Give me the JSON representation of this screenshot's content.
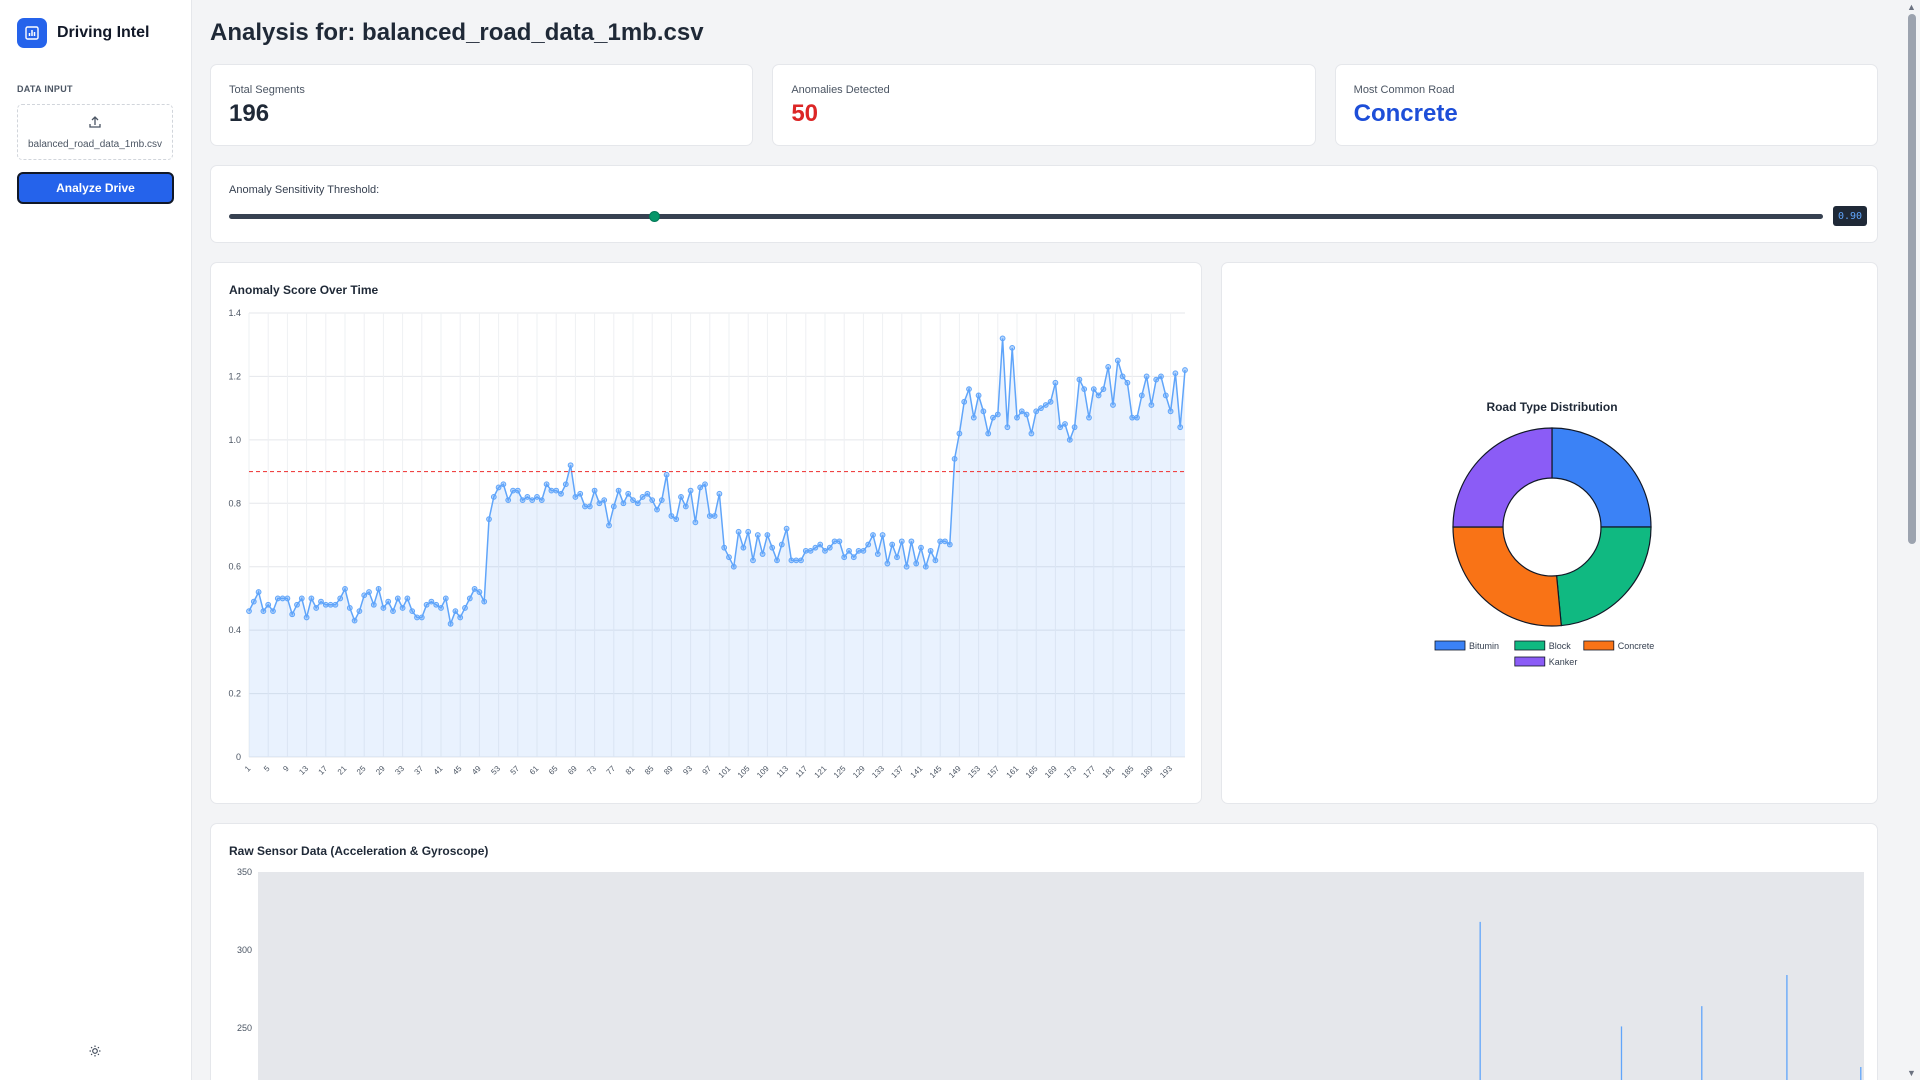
{
  "app": {
    "brand_name": "Driving Intel",
    "logo_icon": "bar-chart-icon"
  },
  "sidebar": {
    "data_input_label": "DATA INPUT",
    "upload_file_name": "balanced_road_data_1mb.csv",
    "upload_icon": "upload-icon",
    "analyze_button_label": "Analyze Drive",
    "theme_icon": "sun-icon"
  },
  "page": {
    "title": "Analysis for: balanced_road_data_1mb.csv"
  },
  "stats": [
    {
      "label": "Total Segments",
      "value": "196",
      "color": "#1f2937"
    },
    {
      "label": "Anomalies Detected",
      "value": "50",
      "color": "#dc2626"
    },
    {
      "label": "Most Common Road",
      "value": "Concrete",
      "color": "#1d4ed8"
    }
  ],
  "threshold": {
    "label": "Anomaly Sensitivity Threshold:",
    "value_text": "0.90",
    "value": 0.9,
    "min": 0.5,
    "max": 2.0
  },
  "chart_data": [
    {
      "type": "line",
      "title": "Anomaly Score Over Time",
      "x_start": 1,
      "x_count": 196,
      "x_tick_labels": [
        "1",
        "5",
        "9",
        "13",
        "17",
        "21",
        "25",
        "29",
        "33",
        "37",
        "41",
        "45",
        "49",
        "53",
        "57",
        "61",
        "65",
        "69",
        "73",
        "77",
        "81",
        "85",
        "89",
        "93",
        "97",
        "101",
        "105",
        "109",
        "113",
        "117",
        "121",
        "125",
        "129",
        "133",
        "137",
        "141",
        "145",
        "149",
        "153",
        "157",
        "161",
        "165",
        "169",
        "173",
        "177",
        "181",
        "185",
        "189",
        "193"
      ],
      "ylim": [
        0,
        1.4
      ],
      "y_ticks": [
        "0",
        "0.2",
        "0.4",
        "0.6",
        "0.8",
        "1.0",
        "1.2",
        "1.4"
      ],
      "threshold_line": 0.9,
      "line_color": "#60a5fa",
      "threshold_color": "#ef4444",
      "values": [
        0.46,
        0.49,
        0.52,
        0.46,
        0.48,
        0.46,
        0.5,
        0.5,
        0.5,
        0.45,
        0.48,
        0.5,
        0.44,
        0.5,
        0.47,
        0.49,
        0.48,
        0.48,
        0.48,
        0.5,
        0.53,
        0.47,
        0.43,
        0.46,
        0.51,
        0.52,
        0.48,
        0.53,
        0.47,
        0.49,
        0.46,
        0.5,
        0.47,
        0.5,
        0.46,
        0.44,
        0.44,
        0.48,
        0.49,
        0.48,
        0.47,
        0.5,
        0.42,
        0.46,
        0.44,
        0.47,
        0.5,
        0.53,
        0.52,
        0.49,
        0.75,
        0.82,
        0.85,
        0.86,
        0.81,
        0.84,
        0.84,
        0.81,
        0.82,
        0.81,
        0.82,
        0.81,
        0.86,
        0.84,
        0.84,
        0.83,
        0.86,
        0.92,
        0.82,
        0.83,
        0.79,
        0.79,
        0.84,
        0.8,
        0.81,
        0.73,
        0.79,
        0.84,
        0.8,
        0.83,
        0.81,
        0.8,
        0.82,
        0.83,
        0.81,
        0.78,
        0.81,
        0.89,
        0.76,
        0.75,
        0.82,
        0.79,
        0.84,
        0.74,
        0.85,
        0.86,
        0.76,
        0.76,
        0.83,
        0.66,
        0.63,
        0.6,
        0.71,
        0.66,
        0.71,
        0.62,
        0.7,
        0.64,
        0.7,
        0.66,
        0.62,
        0.67,
        0.72,
        0.62,
        0.62,
        0.62,
        0.65,
        0.65,
        0.66,
        0.67,
        0.65,
        0.66,
        0.68,
        0.68,
        0.63,
        0.65,
        0.63,
        0.65,
        0.65,
        0.67,
        0.7,
        0.64,
        0.7,
        0.61,
        0.67,
        0.63,
        0.68,
        0.6,
        0.68,
        0.61,
        0.66,
        0.6,
        0.65,
        0.62,
        0.68,
        0.68,
        0.67,
        0.94,
        1.02,
        1.12,
        1.16,
        1.07,
        1.14,
        1.09,
        1.02,
        1.07,
        1.08,
        1.32,
        1.04,
        1.29,
        1.07,
        1.09,
        1.08,
        1.02,
        1.09,
        1.1,
        1.11,
        1.12,
        1.18,
        1.04,
        1.05,
        1.0,
        1.04,
        1.19,
        1.16,
        1.07,
        1.16,
        1.14,
        1.16,
        1.23,
        1.11,
        1.25,
        1.2,
        1.18,
        1.07,
        1.07,
        1.14,
        1.2,
        1.11,
        1.19,
        1.2,
        1.14,
        1.09,
        1.21,
        1.04,
        1.22
      ]
    },
    {
      "type": "pie",
      "title": "Road Type Distribution",
      "donut": true,
      "series": [
        {
          "name": "Bitumin",
          "value": 25,
          "color": "#3b82f6"
        },
        {
          "name": "Block",
          "value": 23.5,
          "color": "#10b981"
        },
        {
          "name": "Concrete",
          "value": 26.5,
          "color": "#f97316"
        },
        {
          "name": "Kanker",
          "value": 25,
          "color": "#8b5cf6"
        }
      ]
    },
    {
      "type": "bar",
      "title": "Raw Sensor Data (Acceleration & Gyroscope)",
      "y_ticks": [
        "250",
        "300",
        "350"
      ],
      "ylim": [
        250,
        350
      ],
      "spikes": [
        {
          "x_fraction": 0.761,
          "value": 318
        },
        {
          "x_fraction": 0.849,
          "value": 251
        },
        {
          "x_fraction": 0.899,
          "value": 264
        },
        {
          "x_fraction": 0.952,
          "value": 284
        },
        {
          "x_fraction": 0.998,
          "value": 225
        }
      ]
    }
  ]
}
